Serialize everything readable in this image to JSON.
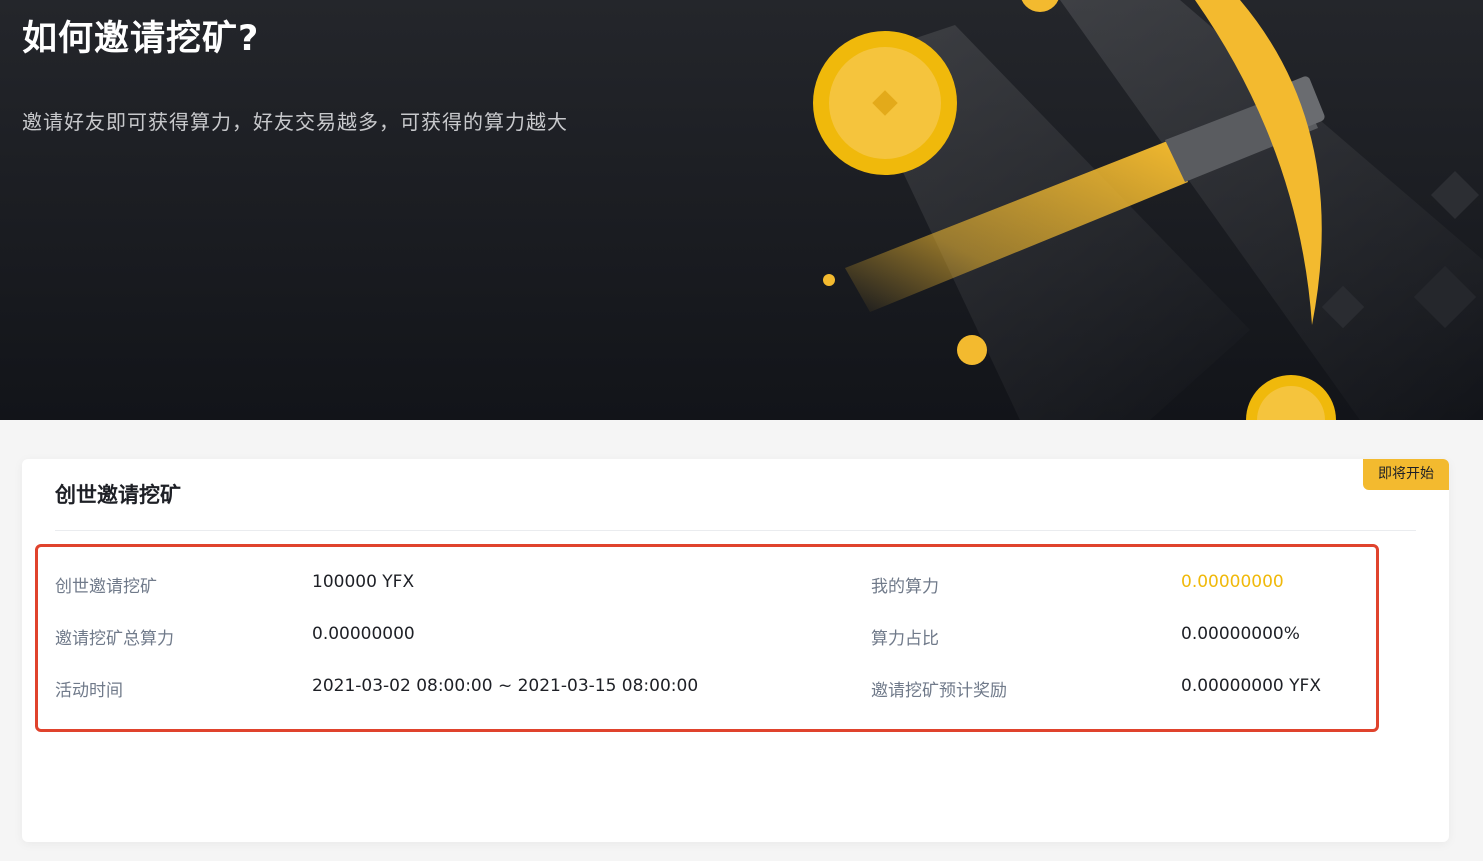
{
  "hero": {
    "title": "如何邀请挖矿?",
    "subtitle": "邀请好友即可获得算力，好友交易越多，可获得的算力越大"
  },
  "card": {
    "title": "创世邀请挖矿",
    "status_badge": "即将开始",
    "rows": [
      {
        "label": "创世邀请挖矿",
        "value": "100000 YFX",
        "right_label": "我的算力",
        "right_value": "0.00000000"
      },
      {
        "label": "邀请挖矿总算力",
        "value": "0.00000000",
        "right_label": "算力占比",
        "right_value": "0.00000000%"
      },
      {
        "label": "活动时间",
        "value": "2021-03-02 08:00:00 ~ 2021-03-15 08:00:00",
        "right_label": "邀请挖矿预计奖励",
        "right_value": "0.00000000 YFX"
      }
    ]
  },
  "colors": {
    "accent": "#f0b90b",
    "badge": "#f3ba2f",
    "highlight_border": "#e0432d",
    "hero_bg": "#1c1e23"
  },
  "icons": [
    "gold-coin-icon",
    "pickaxe-icon",
    "diamond-decoration-icon"
  ]
}
